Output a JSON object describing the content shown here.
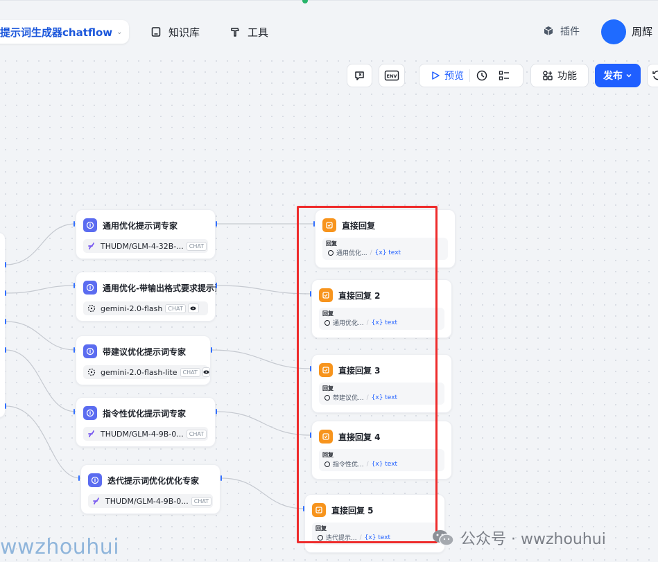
{
  "app": {
    "name": "提示词生成器chatflow"
  },
  "nav": [
    {
      "label": "知识库",
      "icon": "book-icon"
    },
    {
      "label": "工具",
      "icon": "hammer-icon"
    }
  ],
  "header": {
    "plugin_label": "插件",
    "user_name": "周辉"
  },
  "toolbar": {
    "preview_label": "预览",
    "features_label": "功能",
    "publish_label": "发布",
    "env_label": "ENV"
  },
  "llm_nodes": [
    {
      "title": "通用优化提示词专家",
      "model": "THUDM/GLM-4-32B-...",
      "model_icon": "glm-icon",
      "tag": "CHAT",
      "vision": false
    },
    {
      "title": "通用优化-带输出格式要求提示词",
      "model": "gemini-2.0-flash",
      "model_icon": "gemini-icon",
      "tag": "CHAT",
      "vision": true
    },
    {
      "title": "带建议优化提示词专家",
      "model": "gemini-2.0-flash-lite",
      "model_icon": "gemini-icon",
      "tag": "CHAT",
      "vision": true
    },
    {
      "title": "指令性优化提示词专家",
      "model": "THUDM/GLM-4-9B-0...",
      "model_icon": "glm-icon",
      "tag": "CHAT",
      "vision": false
    },
    {
      "title": "迭代提示词优化优化专家",
      "model": "THUDM/GLM-4-9B-0...",
      "model_icon": "glm-icon",
      "tag": "CHAT",
      "vision": false
    }
  ],
  "answer_nodes": [
    {
      "title": "直接回复",
      "reply_label": "回复",
      "source": "通用优化...",
      "var": "{x} text"
    },
    {
      "title": "直接回复 2",
      "reply_label": "回复",
      "source": "通用优化...",
      "var": "{x} text"
    },
    {
      "title": "直接回复 3",
      "reply_label": "回复",
      "source": "带建议优...",
      "var": "{x} text"
    },
    {
      "title": "直接回复 4",
      "reply_label": "回复",
      "source": "指令性优...",
      "var": "{x} text"
    },
    {
      "title": "直接回复 5",
      "reply_label": "回复",
      "source": "迭代提示...",
      "var": "{x} text"
    }
  ],
  "colors": {
    "accent": "#1f5fff",
    "llm_badge": "#5b6cf0",
    "answer_badge": "#f7941d",
    "highlight": "#ee2b2b"
  },
  "watermark": {
    "left": "wwzhouhui",
    "right": "公众号 · wwzhouhui"
  }
}
